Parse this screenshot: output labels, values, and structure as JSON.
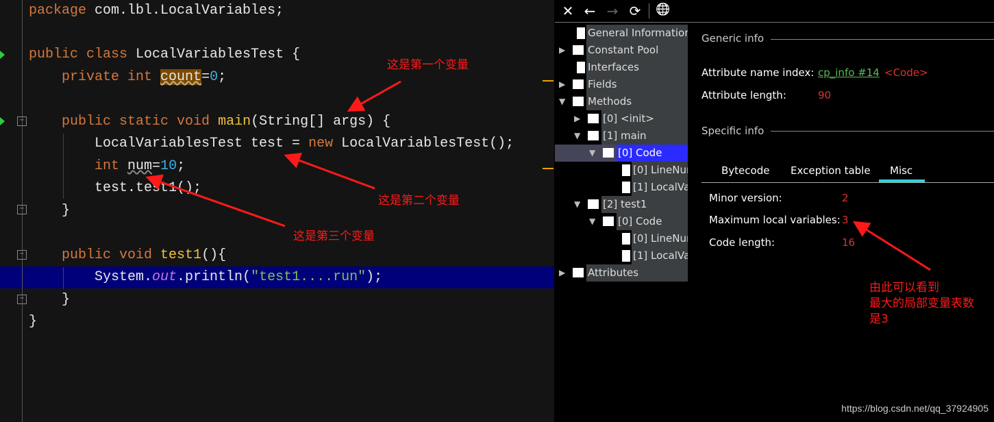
{
  "editor": {
    "lines": {
      "l1": {
        "kw": "package",
        "rest": " com.lbl.LocalVariables;"
      },
      "l3": {
        "kw": "public class",
        "rest": " LocalVariablesTest {"
      },
      "l4": {
        "kw": "private int",
        "field": "count",
        "eq": "=",
        "num": "0",
        "end": ";"
      },
      "l6": {
        "kw": "public static void",
        "fn": "main",
        "rest": "(String[] args) {"
      },
      "l7": {
        "a": "LocalVariablesTest test = ",
        "kw": "new",
        "b": " LocalVariablesTest();"
      },
      "l8": {
        "kw": "int",
        "var": "num",
        "eq": "=",
        "num": "10",
        "end": ";"
      },
      "l9": {
        "text": "test.test1();"
      },
      "l10": {
        "text": "}"
      },
      "l12": {
        "kw": "public void",
        "fn": "test1",
        "rest": "(){"
      },
      "l13": {
        "a": "System.",
        "it": "out",
        "b": ".println(",
        "str": "\"test1....run\"",
        "c": ");"
      },
      "l14": {
        "text": "}"
      },
      "l15": {
        "text": "}"
      }
    }
  },
  "annotations": {
    "first": "这是第一个变量",
    "second": "这是第二个变量",
    "third": "这是第三个变量",
    "conclusion": [
      "由此可以看到",
      "最大的局部变量表数",
      "是3"
    ],
    "color": "#ff1a1a"
  },
  "viewer": {
    "toolbar": {
      "close": "✕",
      "back": "←",
      "forward": "→",
      "refresh": "⟳",
      "browser": "🌐"
    },
    "tree": [
      {
        "label": "General Information",
        "type": "doc"
      },
      {
        "label": "Constant Pool",
        "type": "folder",
        "state": "collapsed"
      },
      {
        "label": "Interfaces",
        "type": "doc"
      },
      {
        "label": "Fields",
        "type": "folder",
        "state": "collapsed"
      },
      {
        "label": "Methods",
        "type": "folder",
        "state": "expanded"
      },
      {
        "label": "[0] <init>",
        "type": "folder",
        "state": "collapsed"
      },
      {
        "label": "[1] main",
        "type": "folder",
        "state": "expanded"
      },
      {
        "label": "[0] Code",
        "type": "folder",
        "state": "expanded",
        "selected": true
      },
      {
        "label": "[0] LineNur",
        "type": "doc"
      },
      {
        "label": "[1] LocalVa",
        "type": "doc"
      },
      {
        "label": "[2] test1",
        "type": "folder",
        "state": "expanded"
      },
      {
        "label": "[0] Code",
        "type": "folder",
        "state": "expanded"
      },
      {
        "label": "[0] LineNur",
        "type": "doc"
      },
      {
        "label": "[1] LocalVa",
        "type": "doc"
      },
      {
        "label": "Attributes",
        "type": "folder",
        "state": "collapsed"
      }
    ],
    "generic": {
      "title": "Generic info",
      "name_index_label": "Attribute name index:",
      "name_index_link": "cp_info #14",
      "name_index_value": "<Code>",
      "length_label": "Attribute length:",
      "length_value": "90"
    },
    "specific": {
      "title": "Specific info",
      "tabs": [
        "Bytecode",
        "Exception table",
        "Misc"
      ],
      "active_tab": "Misc",
      "minor_label": "Minor version:",
      "minor_value": "2",
      "maxlocals_label": "Maximum local variables:",
      "maxlocals_value": "3",
      "codelen_label": "Code length:",
      "codelen_value": "16"
    }
  },
  "watermark": "https://blog.csdn.net/qq_37924905"
}
